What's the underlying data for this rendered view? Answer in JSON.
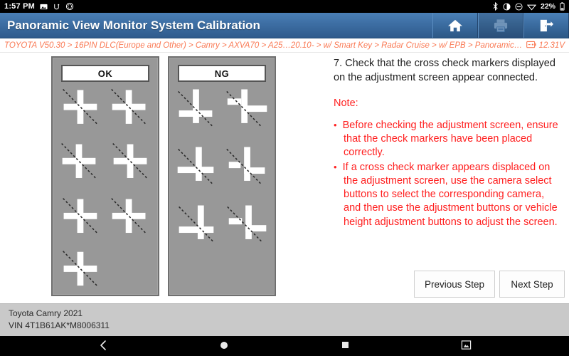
{
  "status_bar": {
    "clock": "1:57 PM",
    "left_icons": [
      "screenshot-icon",
      "usb-debug-icon",
      "do-not-disturb-icon"
    ],
    "right_icons": [
      "bluetooth-icon",
      "contrast-icon",
      "mute-icon",
      "wifi-icon"
    ],
    "battery_percent": "22%"
  },
  "title_bar": {
    "title": "Panoramic View Monitor System Calibration",
    "actions": [
      {
        "name": "home-button",
        "icon": "home-icon",
        "enabled": true
      },
      {
        "name": "print-button",
        "icon": "printer-icon",
        "enabled": false
      },
      {
        "name": "exit-button",
        "icon": "exit-icon",
        "enabled": true
      }
    ]
  },
  "breadcrumb": {
    "path": "TOYOTA V50.30 > 16PIN DLC(Europe and Other) > Camry > AXVA70 > A25…20.10- > w/ Smart Key > Radar Cruise > w/ EPB > Panoramic View Monitor",
    "battery_icon": "battery-icon",
    "voltage": "12.31V"
  },
  "diagram": {
    "panels": [
      {
        "label": "OK",
        "name": "ok-panel"
      },
      {
        "label": "NG",
        "name": "ng-panel"
      }
    ]
  },
  "instruction": {
    "text": "7. Check that the cross check markers displayed on the adjustment screen appear connected."
  },
  "note": {
    "title": "Note:",
    "items": [
      "Before checking the adjustment screen, ensure that the check markers have been placed correctly.",
      "If a cross check marker appears displaced on the adjustment screen, use the camera select buttons to select the corresponding camera, and then use the adjustment buttons or vehicle height adjustment buttons to adjust the screen."
    ]
  },
  "buttons": {
    "previous": "Previous Step",
    "next": "Next Step"
  },
  "footer": {
    "vehicle": "Toyota Camry 2021",
    "vin": "VIN 4T1B61AK*M8006311"
  },
  "nav_bar": {
    "items": [
      "back-icon",
      "home-circle-icon",
      "recents-square-icon",
      "screenshot-icon"
    ]
  },
  "colors": {
    "title_bar": "#3d6ea3",
    "breadcrumb_text": "#fa7a55",
    "note_text": "#ff1f1f",
    "panel_bg": "#989898",
    "footer_bg": "#c9c9c9"
  }
}
